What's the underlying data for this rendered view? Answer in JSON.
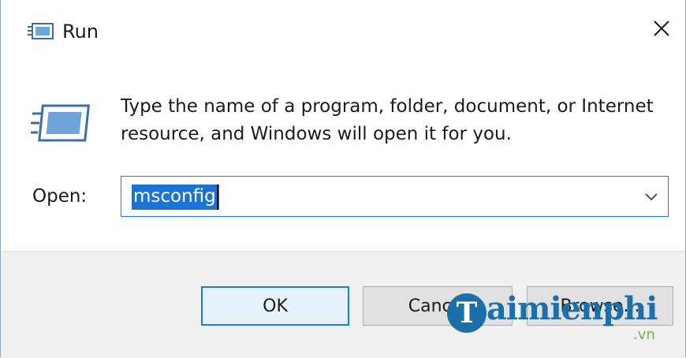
{
  "window": {
    "title": "Run",
    "title_icon": "run-icon",
    "close_icon": "close-icon"
  },
  "content": {
    "description": "Type the name of a program, folder, document, or Internet resource, and Windows will open it for you.",
    "icon": "run-icon"
  },
  "open_field": {
    "label": "Open:",
    "value": "msconfig",
    "dropdown_icon": "chevron-down-icon"
  },
  "buttons": {
    "ok": "OK",
    "cancel": "Cancel",
    "browse": "Browse..."
  },
  "watermark": {
    "logo_letter": "T",
    "text": "aimienphi",
    "suffix": ".vn"
  },
  "colors": {
    "accent": "#1f7ad4",
    "selection": "#1b74d1",
    "footer": "#f0f0f0",
    "button_face": "#e1e1e1"
  }
}
